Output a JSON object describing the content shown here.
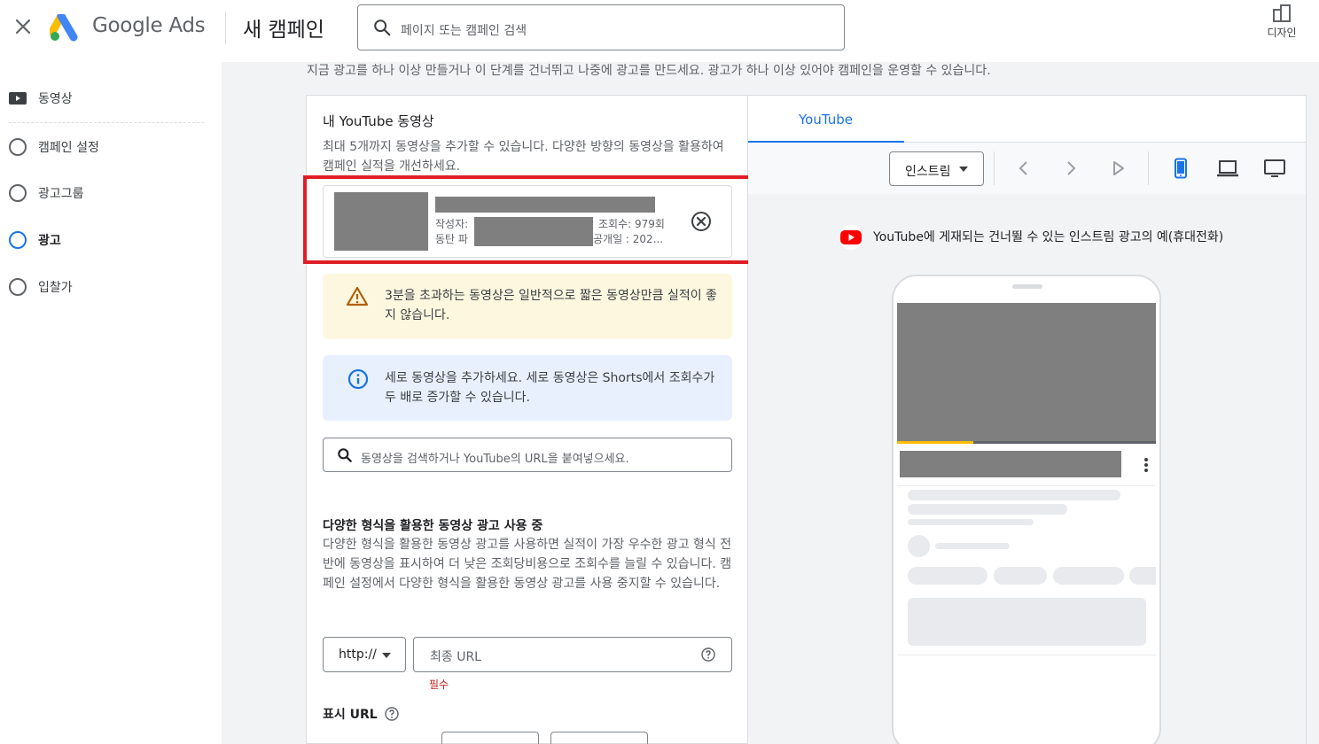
{
  "header": {
    "brand": "Google Ads",
    "campaign_title": "새 캠페인",
    "search_placeholder": "페이지 또는 캠페인 검색",
    "design_label": "디자인"
  },
  "sidebar": {
    "items": [
      {
        "label": "동영상",
        "active": false
      },
      {
        "label": "캠페인 설정",
        "active": false
      },
      {
        "label": "광고그룹",
        "active": false
      },
      {
        "label": "광고",
        "active": true
      },
      {
        "label": "입찰가",
        "active": false
      }
    ]
  },
  "main": {
    "intro": "지금 광고를 하나 이상 만들거나 이 단계를 건너뛰고 나중에 광고를 만드세요. 광고가 하나 이상 있어야 캠페인을 운영할 수 있습니다.",
    "my_videos": {
      "title": "내 YouTube 동영상",
      "description": "최대 5개까지 동영상을 추가할 수 있습니다. 다양한 방향의 동영상을 활용하여 캠페인 실적을 개선하세요.",
      "video": {
        "author_label": "작성자:",
        "views": "조회수: 979회",
        "line2_prefix": "동탄 파",
        "date": "공개일 : 202..."
      }
    },
    "warning_text": "3분을 초과하는 동영상은 일반적으로 짧은 동영상만큼 실적이 좋지 않습니다.",
    "info_text": "세로 동영상을 추가하세요. 세로 동영상은 Shorts에서 조회수가 두 배로 증가할 수 있습니다.",
    "video_search_placeholder": "동영상을 검색하거나 YouTube의 URL을 붙여넣으세요.",
    "multi_format": {
      "title": "다양한 형식을 활용한 동영상 광고 사용 중",
      "description": "다양한 형식을 활용한 동영상 광고를 사용하면 실적이 가장 우수한 광고 형식 전반에 동영상을 표시하여 더 낮은 조회당비용으로 조회수를 늘릴 수 있습니다. 캠페인 설정에서 다양한 형식을 활용한 동영상 광고를 사용 중지할 수 있습니다."
    },
    "protocol_value": "http://",
    "final_url_placeholder": "최종 URL",
    "required_label": "필수",
    "display_url_label": "표시 URL"
  },
  "preview": {
    "tab_label": "YouTube",
    "format_value": "인스트림",
    "caption": "YouTube에 게재되는 건너뛸 수 있는 인스트림 광고의 예(휴대전화)"
  },
  "colors": {
    "accent": "#1a73e8",
    "highlight": "#e01d24",
    "warning_bg": "#fef7e0",
    "info_bg": "#e8f0fe"
  }
}
